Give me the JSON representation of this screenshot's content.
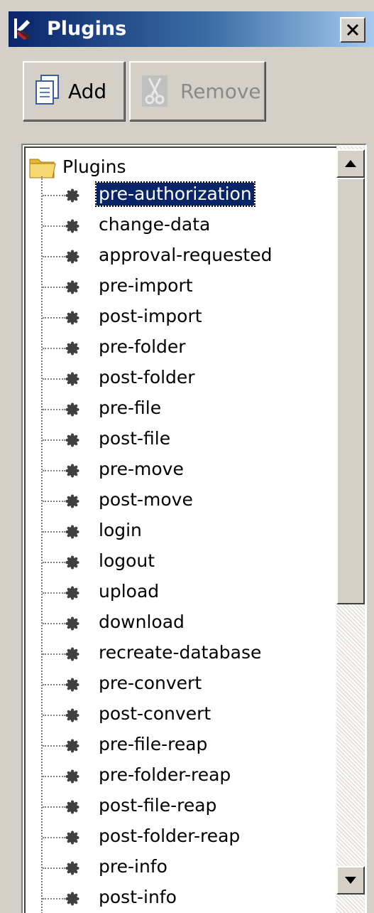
{
  "window": {
    "title": "Plugins",
    "close_label": "x"
  },
  "toolbar": {
    "add_label": "Add",
    "remove_label": "Remove"
  },
  "tree": {
    "root_label": "Plugins",
    "selected_index": 0,
    "items": [
      "pre-authorization",
      "change-data",
      "approval-requested",
      "pre-import",
      "post-import",
      "pre-folder",
      "post-folder",
      "pre-file",
      "post-file",
      "pre-move",
      "post-move",
      "login",
      "logout",
      "upload",
      "download",
      "recreate-database",
      "pre-convert",
      "post-convert",
      "pre-file-reap",
      "pre-folder-reap",
      "post-file-reap",
      "post-folder-reap",
      "pre-info",
      "post-info"
    ]
  },
  "icons": {
    "title": "plugin-wrench-icon",
    "close": "close-icon",
    "add": "add-document-icon",
    "remove": "remove-scissors-icon",
    "root": "folder-icon",
    "item": "gear-bullet-icon",
    "scroll_up": "arrow-up-icon",
    "scroll_down": "arrow-down-icon"
  },
  "colors": {
    "title_bar_start": "#0a246a",
    "title_bar_end": "#a6caf0",
    "selection": "#0a246a",
    "face": "#d4d0c8",
    "disabled_text": "#8a8a8a"
  }
}
